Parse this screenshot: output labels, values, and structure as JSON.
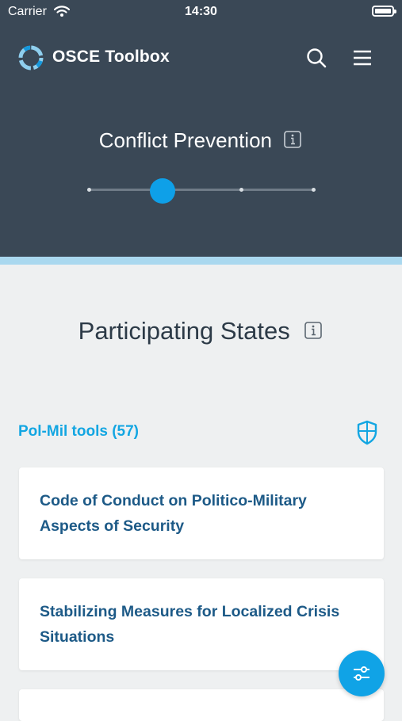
{
  "status_bar": {
    "carrier": "Carrier",
    "time": "14:30"
  },
  "header": {
    "app_title": "OSCE Toolbox",
    "section_title": "Conflict Prevention",
    "slider": {
      "stops": 4,
      "selected_index": 1
    }
  },
  "main": {
    "title": "Participating States",
    "tools_header": "Pol-Mil tools (57)",
    "cards": [
      {
        "title": "Code of Conduct on Politico-Military Aspects of Security"
      },
      {
        "title": "Stabilizing Measures for Localized Crisis Situations"
      },
      {
        "title": ""
      }
    ]
  },
  "colors": {
    "header_bg": "#3a4856",
    "accent": "#10a3e6",
    "accent_strip": "#a9d8ef",
    "card_title": "#1d5a87",
    "page_bg": "#eef0f1"
  },
  "icons": [
    "wifi-icon",
    "battery-icon",
    "logo-icon",
    "search-icon",
    "menu-icon",
    "info-icon",
    "shield-icon",
    "filter-icon"
  ]
}
